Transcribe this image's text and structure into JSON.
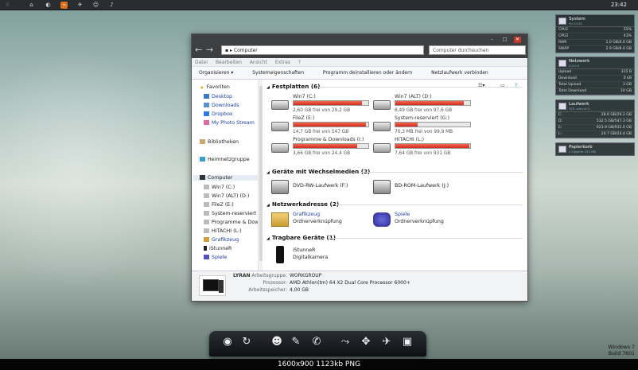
{
  "taskbar": {
    "clock": "23:42"
  },
  "gadgets": {
    "system": {
      "title": "System",
      "subtitle": "00:10:41",
      "rows": [
        {
          "k": "CPU1",
          "v": "55%"
        },
        {
          "k": "CPU2",
          "v": "43%"
        },
        {
          "k": "RAM",
          "v": "1.0 GB/4.0 GB"
        },
        {
          "k": "SWAP",
          "v": "2.9 GB/8.0 GB"
        }
      ]
    },
    "network": {
      "title": "Netzwerk",
      "subtitle": "0.0.0.0",
      "rows": [
        {
          "k": "Upload",
          "v": "315 B"
        },
        {
          "k": "Download",
          "v": "0 kB"
        },
        {
          "k": "Total Upload",
          "v": "3 GB"
        },
        {
          "k": "Total Download",
          "v": "10 GB"
        }
      ]
    },
    "drives": {
      "title": "Laufwerk",
      "subtitle": "915 used of C:",
      "rows": [
        {
          "k": "C:",
          "v": "28.6 GB/29.2 GB"
        },
        {
          "k": "D:",
          "v": "532.5 GB/547.3 GB"
        },
        {
          "k": "E:",
          "v": "923.9 GB/931.0 GB"
        },
        {
          "k": "L:",
          "v": "20.7 GB/24.4 GB"
        }
      ]
    },
    "trash": {
      "title": "Papierkorb",
      "subtitle": "0 Objekte   233 MB"
    }
  },
  "explorer": {
    "address": "Computer",
    "search": "Computer durchsuchen",
    "menu": [
      "Datei",
      "Bearbeiten",
      "Ansicht",
      "Extras",
      "?"
    ],
    "commands": [
      "Organisieren ▾",
      "Systemeigenschaften",
      "Programm deinstallieren oder ändern",
      "Netzlaufwerk verbinden",
      "»"
    ],
    "nav": {
      "favorites": "Favoriten",
      "fav_items": [
        "Desktop",
        "Downloads",
        "Dropbox",
        "My Photo Stream"
      ],
      "libraries": "Bibliotheken",
      "homegroup": "Heimnetzgruppe",
      "computer": "Computer",
      "comp_items": [
        "Win7 (C:)",
        "Win7 (ALT) (D:)",
        "FileZ (E:)",
        "System-reserviert",
        "Programme & Dow",
        "HITACHI (L:)",
        "Grafikzeug",
        "iStunneR",
        "Spiele"
      ]
    },
    "sections": {
      "hdd": "Festplatten (6)",
      "removable": "Geräte mit Wechselmedien (2)",
      "network": "Netzwerkadresse (2)",
      "portable": "Tragbare Geräte (1)"
    },
    "drives": [
      {
        "name": "Win7 (C:)",
        "free": "2,60 GB frei von 29,2 GB",
        "fill": 0.91,
        "color": "red"
      },
      {
        "name": "Win7 (ALT) (D:)",
        "free": "8,49 GB frei von 97,6 GB",
        "fill": 0.91,
        "color": "red"
      },
      {
        "name": "FileZ (E:)",
        "free": "14,7 GB frei von 547 GB",
        "fill": 0.97,
        "color": "red"
      },
      {
        "name": "System-reserviert (G:)",
        "free": "70,3 MB frei von 99,9 MB",
        "fill": 0.3,
        "color": "red"
      },
      {
        "name": "Programme & Downloads (I:)",
        "free": "3,66 GB frei von 24,4 GB",
        "fill": 0.85,
        "color": "red"
      },
      {
        "name": "HITACHI (L:)",
        "free": "7,64 GB frei von 931 GB",
        "fill": 0.99,
        "color": "red"
      }
    ],
    "removable": [
      {
        "name": "DVD-RW-Laufwerk (F:)"
      },
      {
        "name": "BD-ROM-Laufwerk (J:)"
      }
    ],
    "netloc": [
      {
        "name": "Grafikzeug",
        "sub": "Ordnerverknüpfung"
      },
      {
        "name": "Spiele",
        "sub": "Ordnerverknüpfung"
      }
    ],
    "portable": [
      {
        "name": "iStunneR",
        "sub": "Digitalkamera"
      }
    ],
    "details": {
      "name": "LYRAN",
      "labels": [
        "Arbeitsgruppe:",
        "Prozessor:",
        "Arbeitsspeicher:"
      ],
      "values": [
        "WORKGROUP",
        "AMD Athlon(tm) 64 X2 Dual Core Processor 6000+",
        "4,00 GB"
      ]
    }
  },
  "os": {
    "line1": "Windows 7",
    "line2": "Build 7601"
  },
  "footer": "1600x900  1123kb  PNG"
}
